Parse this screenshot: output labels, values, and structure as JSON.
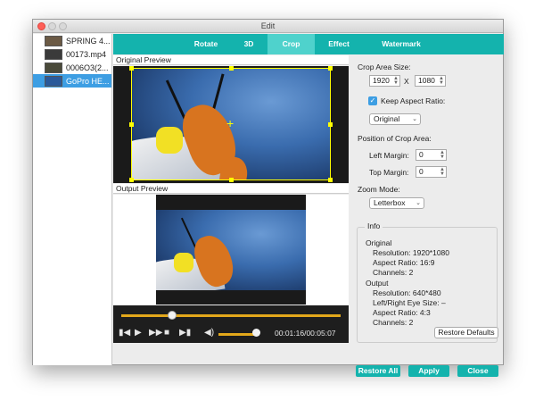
{
  "window": {
    "title": "Edit"
  },
  "files": [
    {
      "name": "SPRING 4...",
      "selected": false,
      "color": "#5b4b3a"
    },
    {
      "name": "00173.mp4",
      "selected": false,
      "color": "#3a3a3a"
    },
    {
      "name": "0006O3(2...",
      "selected": false,
      "color": "#4a4a3a"
    },
    {
      "name": "GoPro HE...",
      "selected": true,
      "color": "#2a5a9a"
    }
  ],
  "tabs": [
    {
      "label": "Rotate",
      "active": false
    },
    {
      "label": "3D",
      "active": false
    },
    {
      "label": "Crop",
      "active": true
    },
    {
      "label": "Effect",
      "active": false
    },
    {
      "label": "Watermark",
      "active": false
    }
  ],
  "preview": {
    "original_title": "Original Preview",
    "output_title": "Output Preview"
  },
  "player": {
    "progress": 0.23,
    "volume": 0.85,
    "timecode": "00:01:16/00:05:07",
    "play_icon": "play-icon",
    "volume_icon": "speaker-icon"
  },
  "crop": {
    "area_size_label": "Crop Area Size:",
    "width": "1920",
    "separator": "X",
    "height": "1080",
    "keep_aspect_label": "Keep Aspect Ratio:",
    "keep_aspect_checked": true,
    "aspect_value": "Original",
    "position_label": "Position of Crop Area:",
    "left_margin_label": "Left Margin:",
    "left_margin": "0",
    "top_margin_label": "Top Margin:",
    "top_margin": "0",
    "zoom_mode_label": "Zoom Mode:",
    "zoom_mode": "Letterbox"
  },
  "info": {
    "legend": "Info",
    "original_heading": "Original",
    "original_resolution": "Resolution: 1920*1080",
    "original_aspect": "Aspect Ratio: 16:9",
    "original_channels": "Channels: 2",
    "output_heading": "Output",
    "output_resolution": "Resolution: 640*480",
    "output_eye_size": "Left/Right Eye Size: –",
    "output_aspect": "Aspect Ratio: 4:3",
    "output_channels": "Channels: 2"
  },
  "buttons": {
    "restore_defaults": "Restore Defaults",
    "restore_all": "Restore All",
    "apply": "Apply",
    "close": "Close"
  },
  "colors": {
    "accent": "#14b3ad",
    "seek": "#e3a81b",
    "crop_frame": "#ffff00",
    "selection": "#3d9ee3"
  }
}
